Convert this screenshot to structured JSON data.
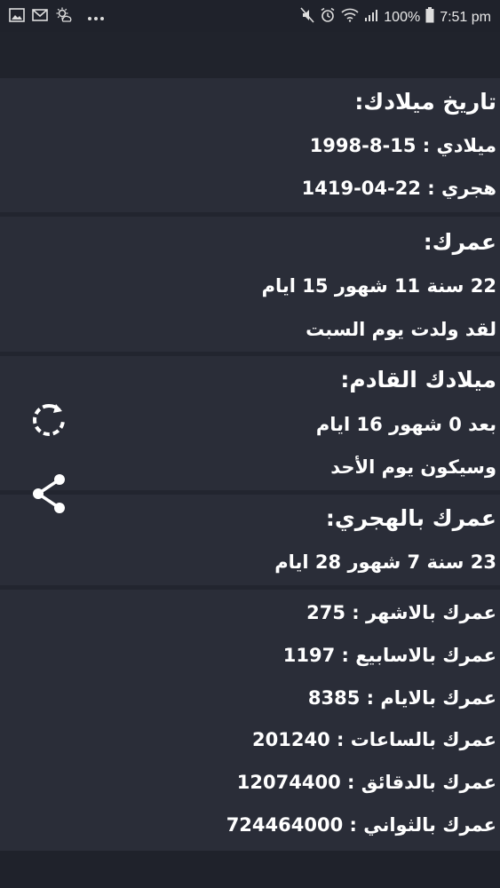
{
  "status_bar": {
    "time": "7:51 pm",
    "battery": "100%",
    "icons_left": [
      "image-icon",
      "gmail-icon",
      "weather-icon",
      "more-dots-icon"
    ],
    "icons_right": [
      "mute-icon",
      "alarm-icon",
      "wifi-icon",
      "signal-icon",
      "battery-icon"
    ]
  },
  "birth_date": {
    "title": "تاريخ ميلادك:",
    "gregorian": "ميلادي : 15-8-1998",
    "hijri": "هجري : 22-04-1419"
  },
  "age": {
    "title": "عمرك:",
    "duration": "22 سنة 11 شهور 15 ايام",
    "born_day": "لقد ولدت يوم السبت"
  },
  "next_birthday": {
    "title": "ميلادك القادم:",
    "remaining": "بعد 0 شهور 16 ايام",
    "day": "وسيكون يوم الأحد"
  },
  "hijri_age": {
    "title": "عمرك بالهجري:",
    "duration": "23 سنة 7 شهور 28 ايام"
  },
  "totals": {
    "months": "عمرك بالاشهر : 275",
    "weeks": "عمرك بالاسابيع : 1197",
    "days": "عمرك بالايام : 8385",
    "hours": "عمرك بالساعات : 201240",
    "minutes": "عمرك بالدقائق : 12074400",
    "seconds": "عمرك بالثواني : 724464000"
  },
  "actions": {
    "refresh_icon": "refresh-icon",
    "share_icon": "share-icon"
  },
  "colors": {
    "background": "#22252f",
    "card": "#2a2d38",
    "text": "#ffffff"
  }
}
